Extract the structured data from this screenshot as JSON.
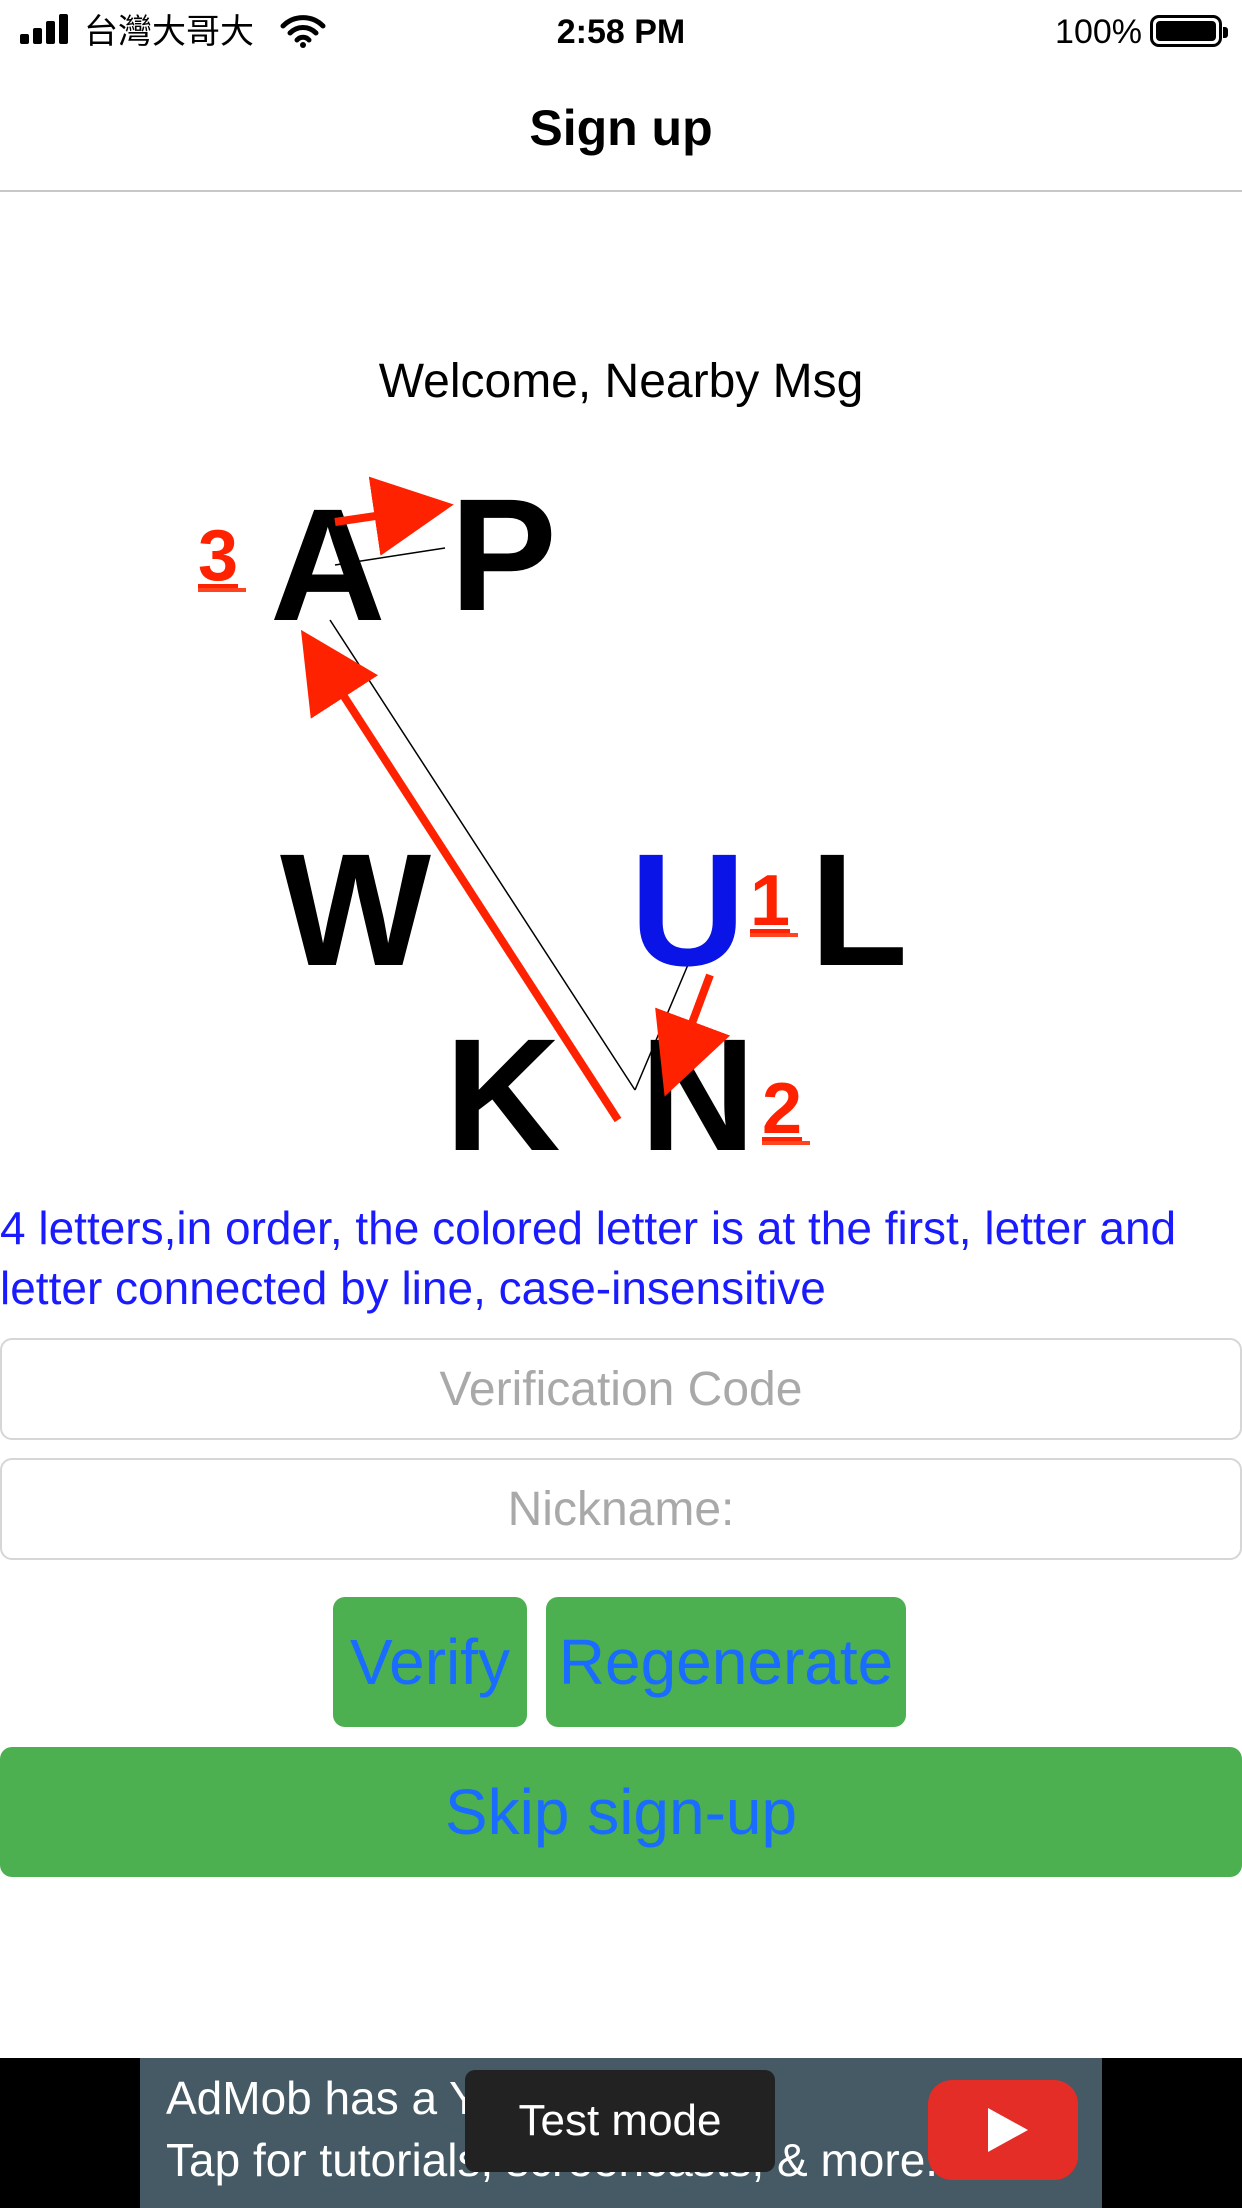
{
  "status_bar": {
    "carrier": "台灣大哥大",
    "time": "2:58 PM",
    "battery_percent": "100%",
    "icons": [
      "signal-icon",
      "wifi-icon",
      "battery-icon"
    ]
  },
  "nav": {
    "title": "Sign up"
  },
  "welcome": "Welcome, Nearby Msg",
  "captcha": {
    "letters": [
      {
        "char": "A",
        "color": "#000000"
      },
      {
        "char": "P",
        "color": "#000000"
      },
      {
        "char": "W",
        "color": "#000000"
      },
      {
        "char": "U",
        "color": "#0a14e6"
      },
      {
        "char": "L",
        "color": "#000000"
      },
      {
        "char": "K",
        "color": "#000000"
      },
      {
        "char": "N",
        "color": "#000000"
      }
    ],
    "step_labels": [
      "1",
      "2",
      "3"
    ],
    "arrow_color": "#ff2200"
  },
  "instructions": "4 letters,in order, the colored letter is at the first, letter and letter connected by line, case-insensitive",
  "form": {
    "code_placeholder": "Verification Code",
    "nickname_placeholder": "Nickname:"
  },
  "buttons": {
    "verify": "Verify",
    "regenerate": "Regenerate",
    "skip": "Skip sign-up"
  },
  "ad": {
    "line1": "AdMob has a Yo",
    "line2": "Tap for tutorials, screencasts, & more.",
    "test_badge": "Test mode",
    "icon": "youtube-play-icon"
  },
  "colors": {
    "button_bg": "#4caf50",
    "button_text": "#1a6bff",
    "instructions_text": "#1a1aff"
  }
}
